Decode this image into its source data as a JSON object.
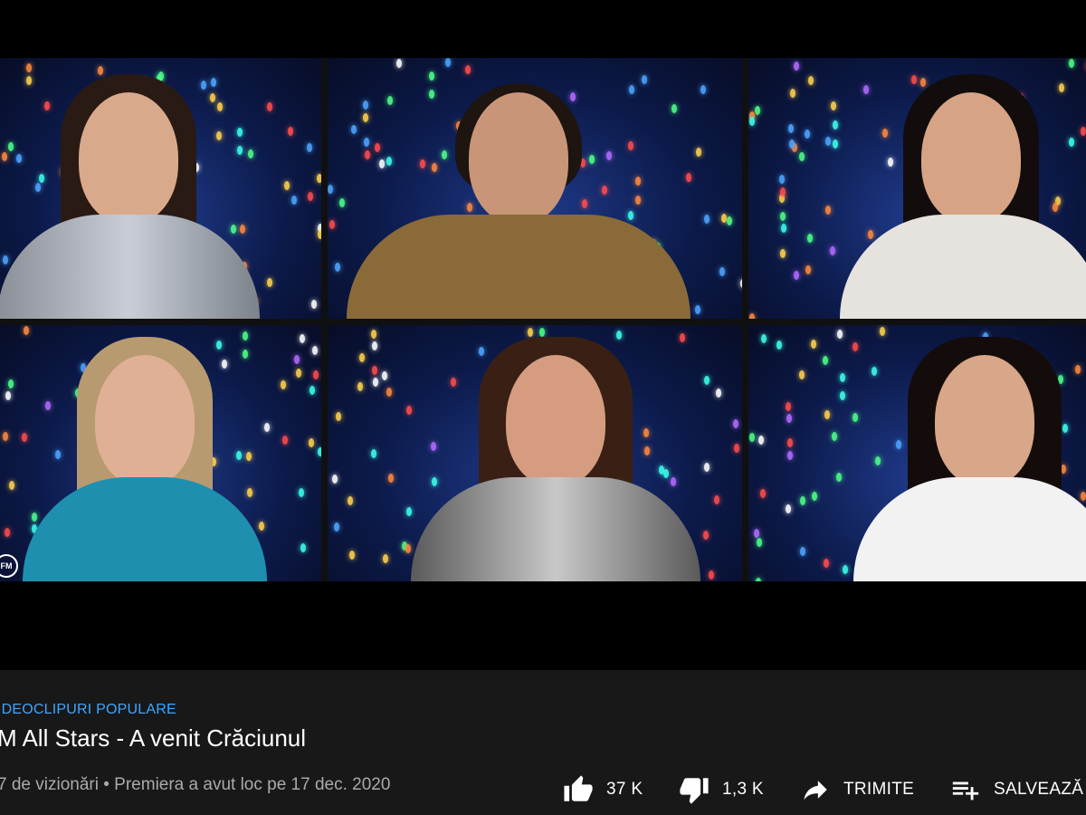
{
  "video": {
    "hashtag": "IDEOCLIPURI POPULARE",
    "title": "M All Stars - A venit Crăciunul",
    "views": "7 de vizionări",
    "separator": "•",
    "premiere": "Premiera a avut loc pe 17 dec. 2020",
    "watermark": "FM"
  },
  "actions": {
    "like_count": "37 K",
    "dislike_count": "1,3 K",
    "share_label": "TRIMITE",
    "save_label": "SALVEAZĂ"
  },
  "colors": {
    "background": "#000000",
    "info_panel": "#181818",
    "hashtag": "#3ea6ff",
    "meta": "#aaaaaa"
  },
  "icons": [
    "thumbs-up-icon",
    "thumbs-down-icon",
    "share-arrow-icon",
    "add-to-playlist-icon"
  ]
}
